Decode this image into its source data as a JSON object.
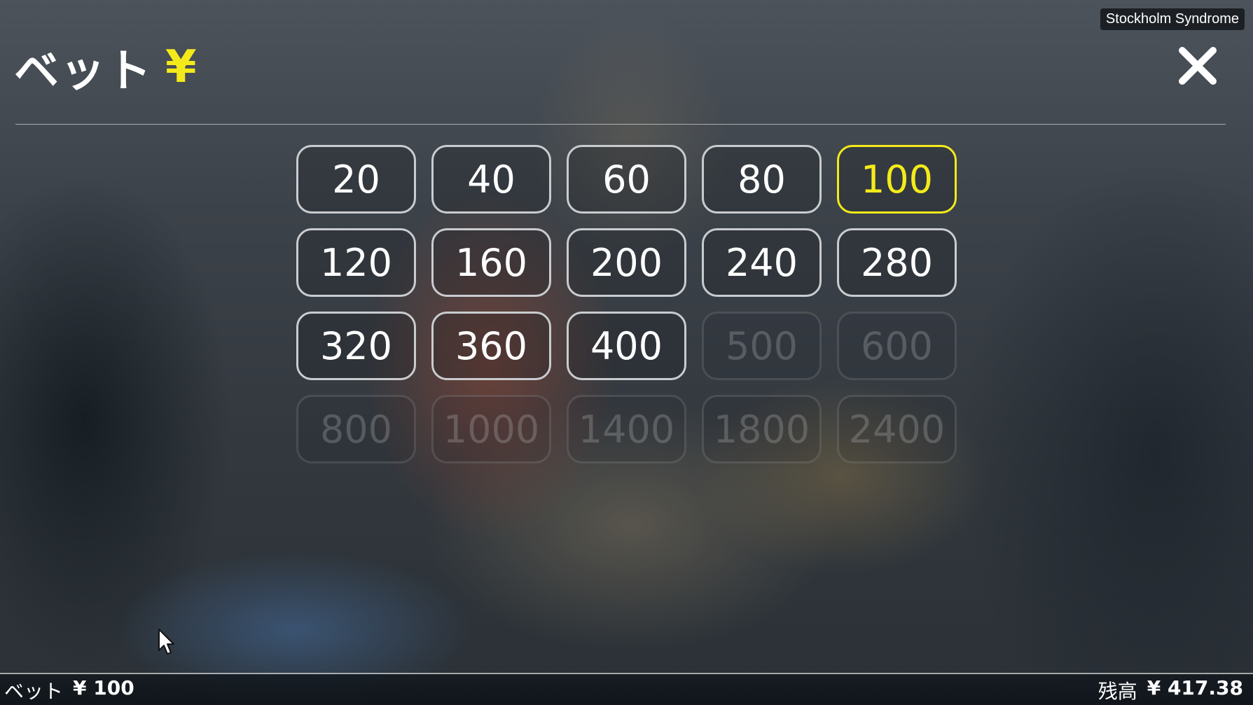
{
  "header": {
    "title": "ベット",
    "currency_symbol": "¥"
  },
  "game_badge": "Stockholm Syndrome",
  "bet_options": [
    {
      "label": "20",
      "state": "enabled"
    },
    {
      "label": "40",
      "state": "enabled"
    },
    {
      "label": "60",
      "state": "enabled"
    },
    {
      "label": "80",
      "state": "enabled"
    },
    {
      "label": "100",
      "state": "selected"
    },
    {
      "label": "120",
      "state": "enabled"
    },
    {
      "label": "160",
      "state": "enabled"
    },
    {
      "label": "200",
      "state": "enabled"
    },
    {
      "label": "240",
      "state": "enabled"
    },
    {
      "label": "280",
      "state": "enabled"
    },
    {
      "label": "320",
      "state": "enabled"
    },
    {
      "label": "360",
      "state": "enabled"
    },
    {
      "label": "400",
      "state": "enabled"
    },
    {
      "label": "500",
      "state": "disabled"
    },
    {
      "label": "600",
      "state": "disabled"
    },
    {
      "label": "800",
      "state": "disabled"
    },
    {
      "label": "1000",
      "state": "disabled"
    },
    {
      "label": "1400",
      "state": "disabled"
    },
    {
      "label": "1800",
      "state": "disabled"
    },
    {
      "label": "2400",
      "state": "disabled"
    }
  ],
  "footer": {
    "bet_label": "ベット",
    "bet_value": "¥ 100",
    "balance_label": "残高",
    "balance_value": "¥ 417.38"
  },
  "colors": {
    "accent": "#f4ea1a",
    "button_border": "#c9cccf",
    "text": "#ffffff"
  },
  "icons": {
    "close": "close-icon",
    "cursor": "mouse-cursor-icon"
  }
}
